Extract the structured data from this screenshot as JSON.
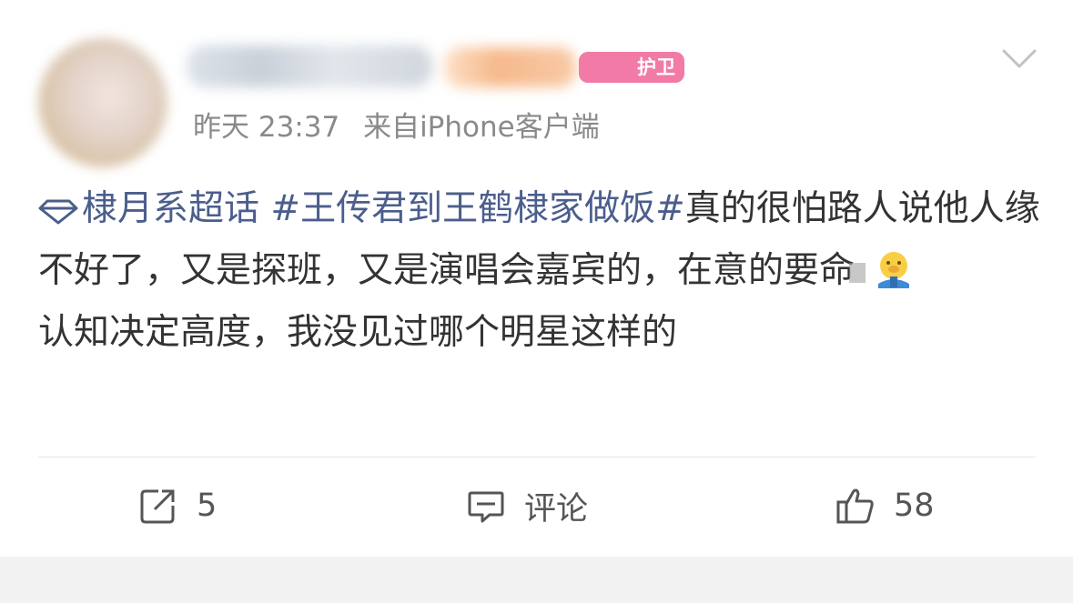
{
  "post": {
    "author_badge_text": "护卫",
    "meta_time": "昨天 23:37",
    "meta_from": "来自",
    "meta_source": "iPhone客户端",
    "supertopic": "棣月系超话",
    "hashtag": "#王传君到王鹤棣家做饭#",
    "text_1": "真的很怕路人说他人缘不好了，又是探班，又是演唱会嘉宾的，在意的要命",
    "text_2": "认知决定高度，我没见过哪个明星这样的",
    "emoji": "hug-face-emoji"
  },
  "actions": {
    "repost_count": "5",
    "comment_label": "评论",
    "like_count": "58"
  },
  "colors": {
    "topic_link": "#4b5e8c",
    "meta_text": "#8a8a8a",
    "body_text": "#333333",
    "badge_pink": "#f27aa7"
  }
}
